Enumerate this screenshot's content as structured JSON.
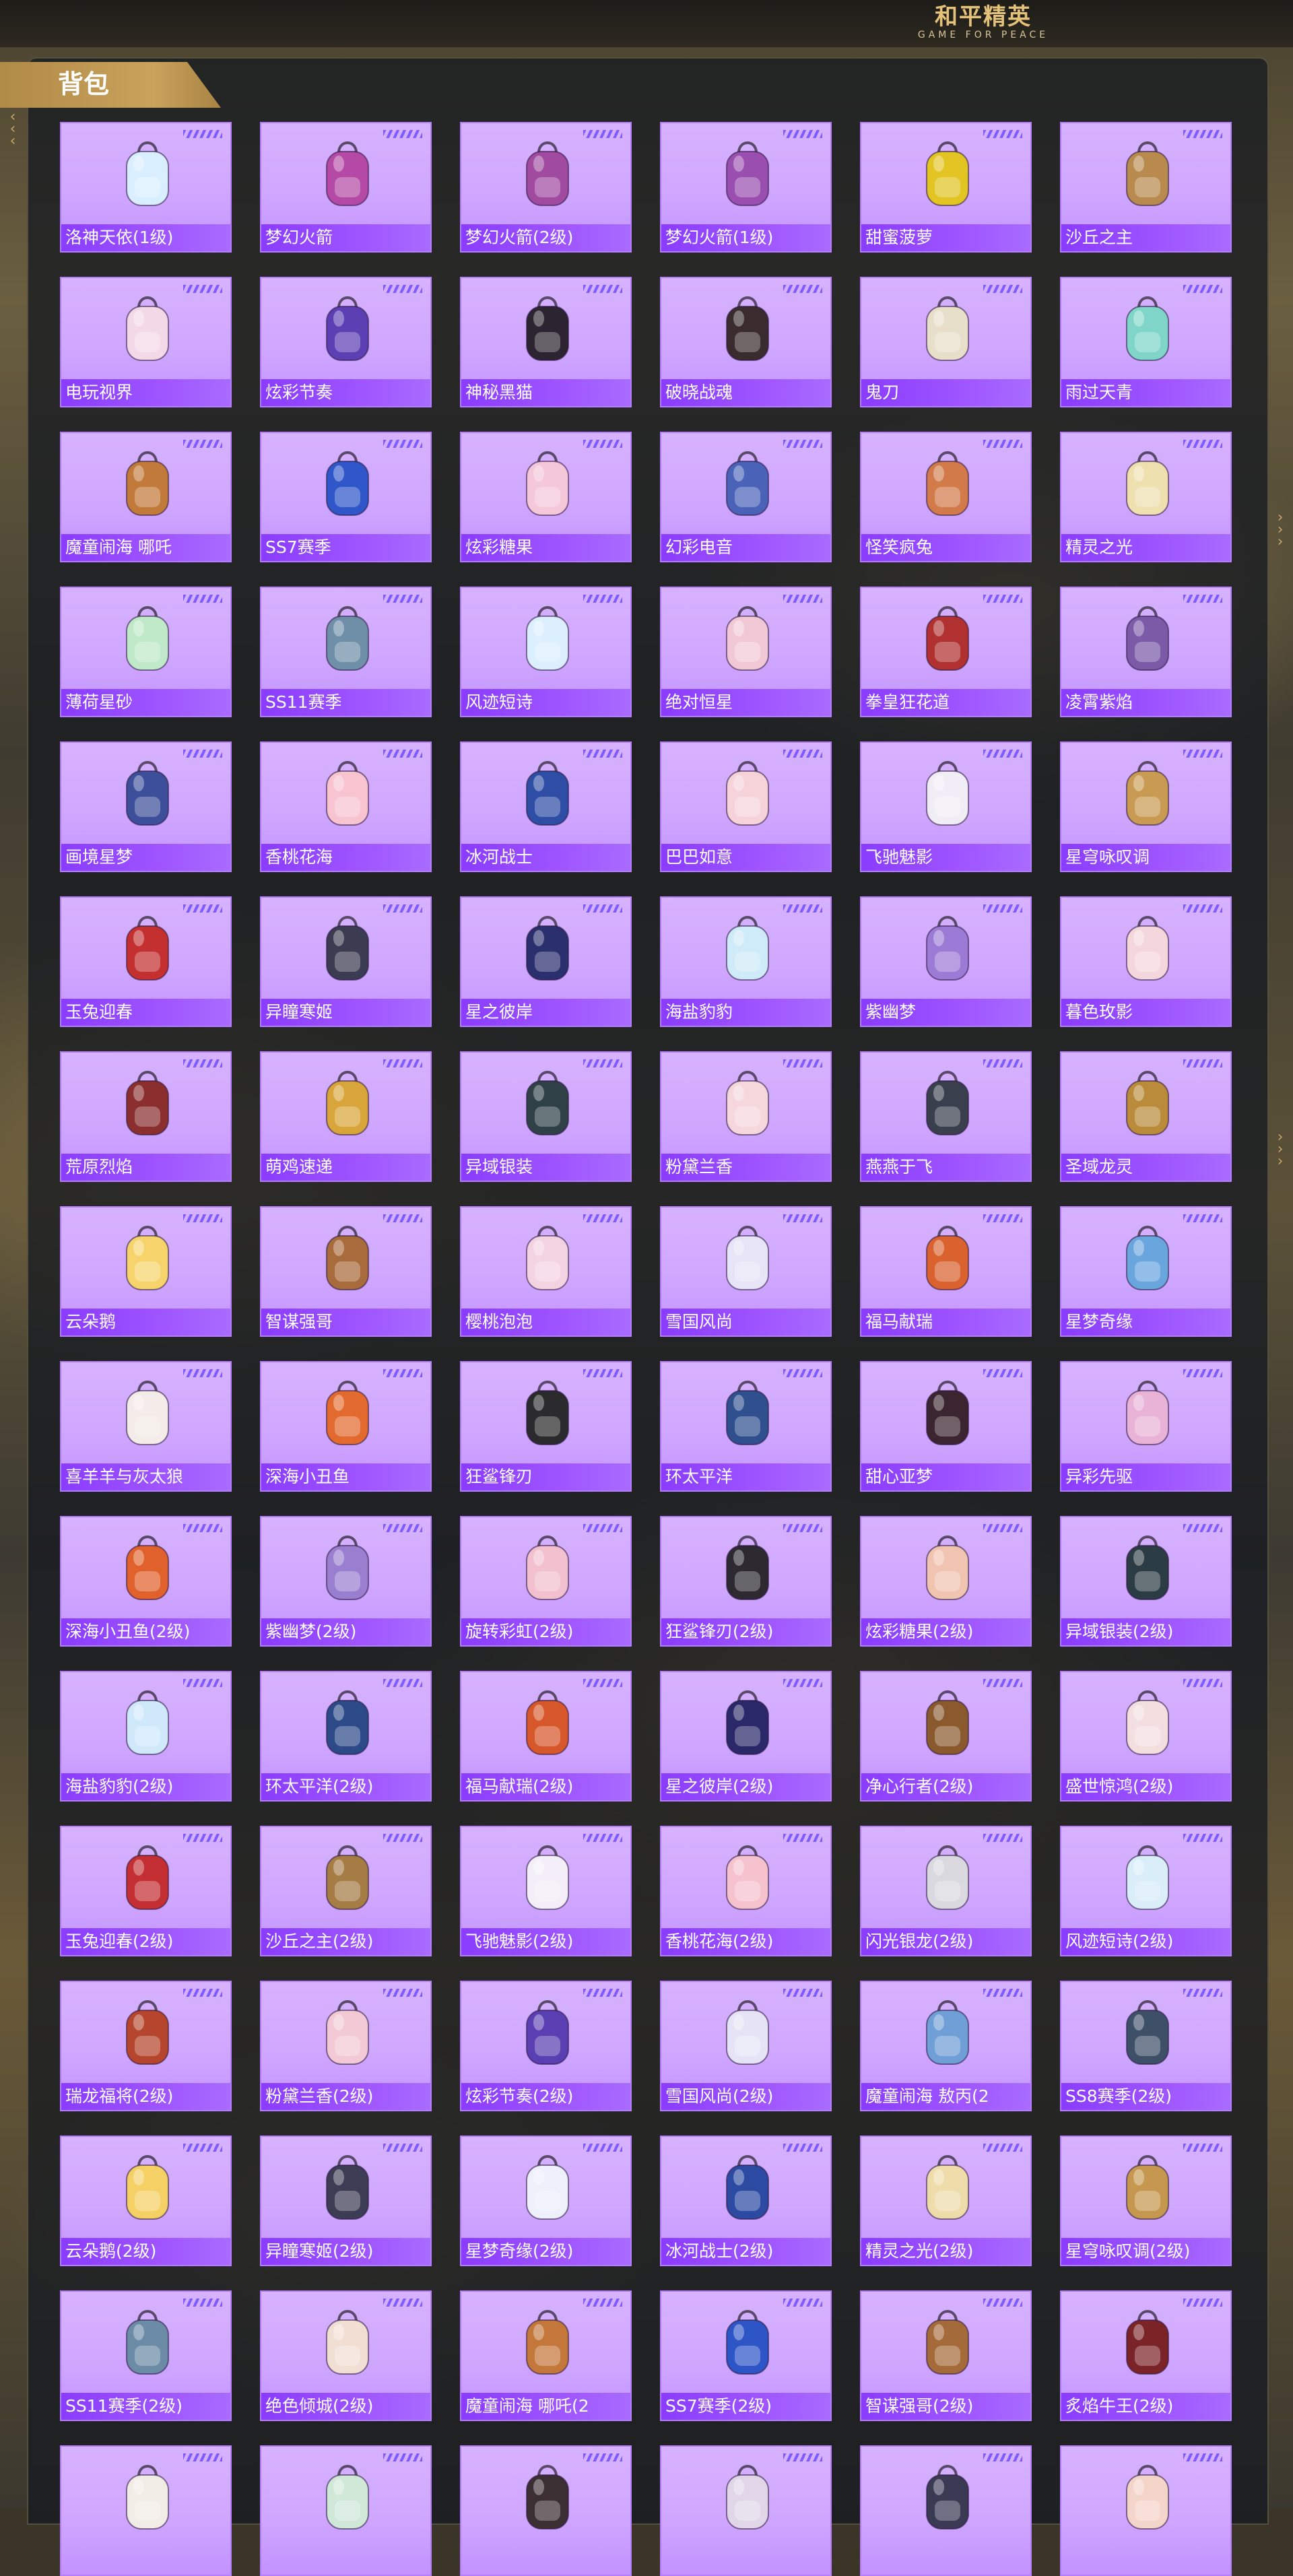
{
  "brand": {
    "title_cn": "和平精英",
    "title_en": "GAME FOR PEACE"
  },
  "section": {
    "title": "背包"
  },
  "items": [
    {
      "name": "洛神天依(1级)",
      "color": "#d9efff"
    },
    {
      "name": "梦幻火箭",
      "color": "#b54aa6"
    },
    {
      "name": "梦幻火箭(2级)",
      "color": "#a04aa0"
    },
    {
      "name": "梦幻火箭(1级)",
      "color": "#9a4fb0"
    },
    {
      "name": "甜蜜菠萝",
      "color": "#e2c423"
    },
    {
      "name": "沙丘之主",
      "color": "#b98a4e"
    },
    {
      "name": "电玩视界",
      "color": "#f3d8e8"
    },
    {
      "name": "炫彩节奏",
      "color": "#5d3fb4"
    },
    {
      "name": "神秘黑猫",
      "color": "#2c2430"
    },
    {
      "name": "破晓战魂",
      "color": "#3a2b2e"
    },
    {
      "name": "鬼刀",
      "color": "#e7dfc9"
    },
    {
      "name": "雨过天青",
      "color": "#7fd6c8"
    },
    {
      "name": "魔童闹海 哪吒",
      "color": "#c27a3a"
    },
    {
      "name": "SS7赛季",
      "color": "#2f57c9"
    },
    {
      "name": "炫彩糖果",
      "color": "#f4c7d9"
    },
    {
      "name": "幻彩电音",
      "color": "#4a63b8"
    },
    {
      "name": "怪笑疯兔",
      "color": "#d27a4a"
    },
    {
      "name": "精灵之光",
      "color": "#efe0b0"
    },
    {
      "name": "薄荷星砂",
      "color": "#bfe9c8"
    },
    {
      "name": "SS11赛季",
      "color": "#6f8fa9"
    },
    {
      "name": "风迹短诗",
      "color": "#dcefff"
    },
    {
      "name": "绝对恒星",
      "color": "#f1c9d6"
    },
    {
      "name": "拳皇狂花道",
      "color": "#b03130"
    },
    {
      "name": "凌霄紫焰",
      "color": "#7b5aa8"
    },
    {
      "name": "画境星梦",
      "color": "#3d4f9a"
    },
    {
      "name": "香桃花海",
      "color": "#f7c4d0"
    },
    {
      "name": "冰河战士",
      "color": "#2e4da5"
    },
    {
      "name": "巴巴如意",
      "color": "#f6d3d8"
    },
    {
      "name": "飞驰魅影",
      "color": "#f1edf6"
    },
    {
      "name": "星穹咏叹调",
      "color": "#c99a52"
    },
    {
      "name": "玉兔迎春",
      "color": "#c43030"
    },
    {
      "name": "异瞳寒姬",
      "color": "#3b3b52"
    },
    {
      "name": "星之彼岸",
      "color": "#2a2f6e"
    },
    {
      "name": "海盐豹豹",
      "color": "#cfeaf8"
    },
    {
      "name": "紫幽梦",
      "color": "#9b7bd6"
    },
    {
      "name": "暮色玫影",
      "color": "#f4d7dc"
    },
    {
      "name": "荒原烈焰",
      "color": "#8b2f2e"
    },
    {
      "name": "萌鸡速递",
      "color": "#d8a53a"
    },
    {
      "name": "异域银装",
      "color": "#2f4047"
    },
    {
      "name": "粉黛兰香",
      "color": "#f5d7dc"
    },
    {
      "name": "燕燕于飞",
      "color": "#3a3f4e"
    },
    {
      "name": "圣域龙灵",
      "color": "#b98b3a"
    },
    {
      "name": "云朵鹅",
      "color": "#f6d46b"
    },
    {
      "name": "智谋强哥",
      "color": "#a86b3b"
    },
    {
      "name": "樱桃泡泡",
      "color": "#f3d3e1"
    },
    {
      "name": "雪国风尚",
      "color": "#e6e4f6"
    },
    {
      "name": "福马献瑞",
      "color": "#d9622f"
    },
    {
      "name": "星梦奇缘",
      "color": "#6aa6de"
    },
    {
      "name": "喜羊羊与灰太狼",
      "color": "#f4ece8"
    },
    {
      "name": "深海小丑鱼",
      "color": "#e36a2e"
    },
    {
      "name": "狂鲨锋刃",
      "color": "#2b2a2c"
    },
    {
      "name": "环太平洋",
      "color": "#2f4f8e"
    },
    {
      "name": "甜心亚梦",
      "color": "#3a2530"
    },
    {
      "name": "异彩先驱",
      "color": "#e8b3d6"
    },
    {
      "name": "深海小丑鱼(2级)",
      "color": "#e0612c"
    },
    {
      "name": "紫幽梦(2级)",
      "color": "#9a7fd0"
    },
    {
      "name": "旋转彩虹(2级)",
      "color": "#f2c0cf"
    },
    {
      "name": "狂鲨锋刃(2级)",
      "color": "#2c2a30"
    },
    {
      "name": "炫彩糖果(2级)",
      "color": "#f0c4b0"
    },
    {
      "name": "异域银装(2级)",
      "color": "#2c3c44"
    },
    {
      "name": "海盐豹豹(2级)",
      "color": "#cfe9fb"
    },
    {
      "name": "环太平洋(2级)",
      "color": "#2d4a88"
    },
    {
      "name": "福马献瑞(2级)",
      "color": "#d6572a"
    },
    {
      "name": "星之彼岸(2级)",
      "color": "#2a2868"
    },
    {
      "name": "净心行者(2级)",
      "color": "#8a5a2e"
    },
    {
      "name": "盛世惊鸿(2级)",
      "color": "#f3dfe0"
    },
    {
      "name": "玉兔迎春(2级)",
      "color": "#c42f33"
    },
    {
      "name": "沙丘之主(2级)",
      "color": "#a67c45"
    },
    {
      "name": "飞驰魅影(2级)",
      "color": "#f3eef8"
    },
    {
      "name": "香桃花海(2级)",
      "color": "#f6c2cd"
    },
    {
      "name": "闪光银龙(2级)",
      "color": "#d9d9df"
    },
    {
      "name": "风迹短诗(2级)",
      "color": "#d9eef9"
    },
    {
      "name": "瑞龙福将(2级)",
      "color": "#b5452c"
    },
    {
      "name": "粉黛兰香(2级)",
      "color": "#f2c9d4"
    },
    {
      "name": "炫彩节奏(2级)",
      "color": "#5a3fb2"
    },
    {
      "name": "雪国风尚(2级)",
      "color": "#e5e3f5"
    },
    {
      "name": "魔童闹海 敖丙(2",
      "color": "#6f9fd6"
    },
    {
      "name": "SS8赛季(2级)",
      "color": "#3e5068"
    },
    {
      "name": "云朵鹅(2级)",
      "color": "#f5d064"
    },
    {
      "name": "异瞳寒姬(2级)",
      "color": "#3c3c55"
    },
    {
      "name": "星梦奇缘(2级)",
      "color": "#eef0fb"
    },
    {
      "name": "冰河战士(2级)",
      "color": "#2d4aa3"
    },
    {
      "name": "精灵之光(2级)",
      "color": "#eedcaa"
    },
    {
      "name": "星穹咏叹调(2级)",
      "color": "#c6974f"
    },
    {
      "name": "SS11赛季(2级)",
      "color": "#6b8ba6"
    },
    {
      "name": "绝色倾城(2级)",
      "color": "#f1dfd4"
    },
    {
      "name": "魔童闹海 哪吒(2",
      "color": "#c4773a"
    },
    {
      "name": "SS7赛季(2级)",
      "color": "#2e55c6"
    },
    {
      "name": "智谋强哥(2级)",
      "color": "#a56a3a"
    },
    {
      "name": "炙焰牛王(2级)",
      "color": "#7a2428"
    },
    {
      "name": "",
      "color": "#f2ece6"
    },
    {
      "name": "",
      "color": "#cfe8d8"
    },
    {
      "name": "",
      "color": "#3b2f33"
    },
    {
      "name": "",
      "color": "#e0d6e8"
    },
    {
      "name": "",
      "color": "#3a3a55"
    },
    {
      "name": "",
      "color": "#f3d5c9"
    }
  ]
}
